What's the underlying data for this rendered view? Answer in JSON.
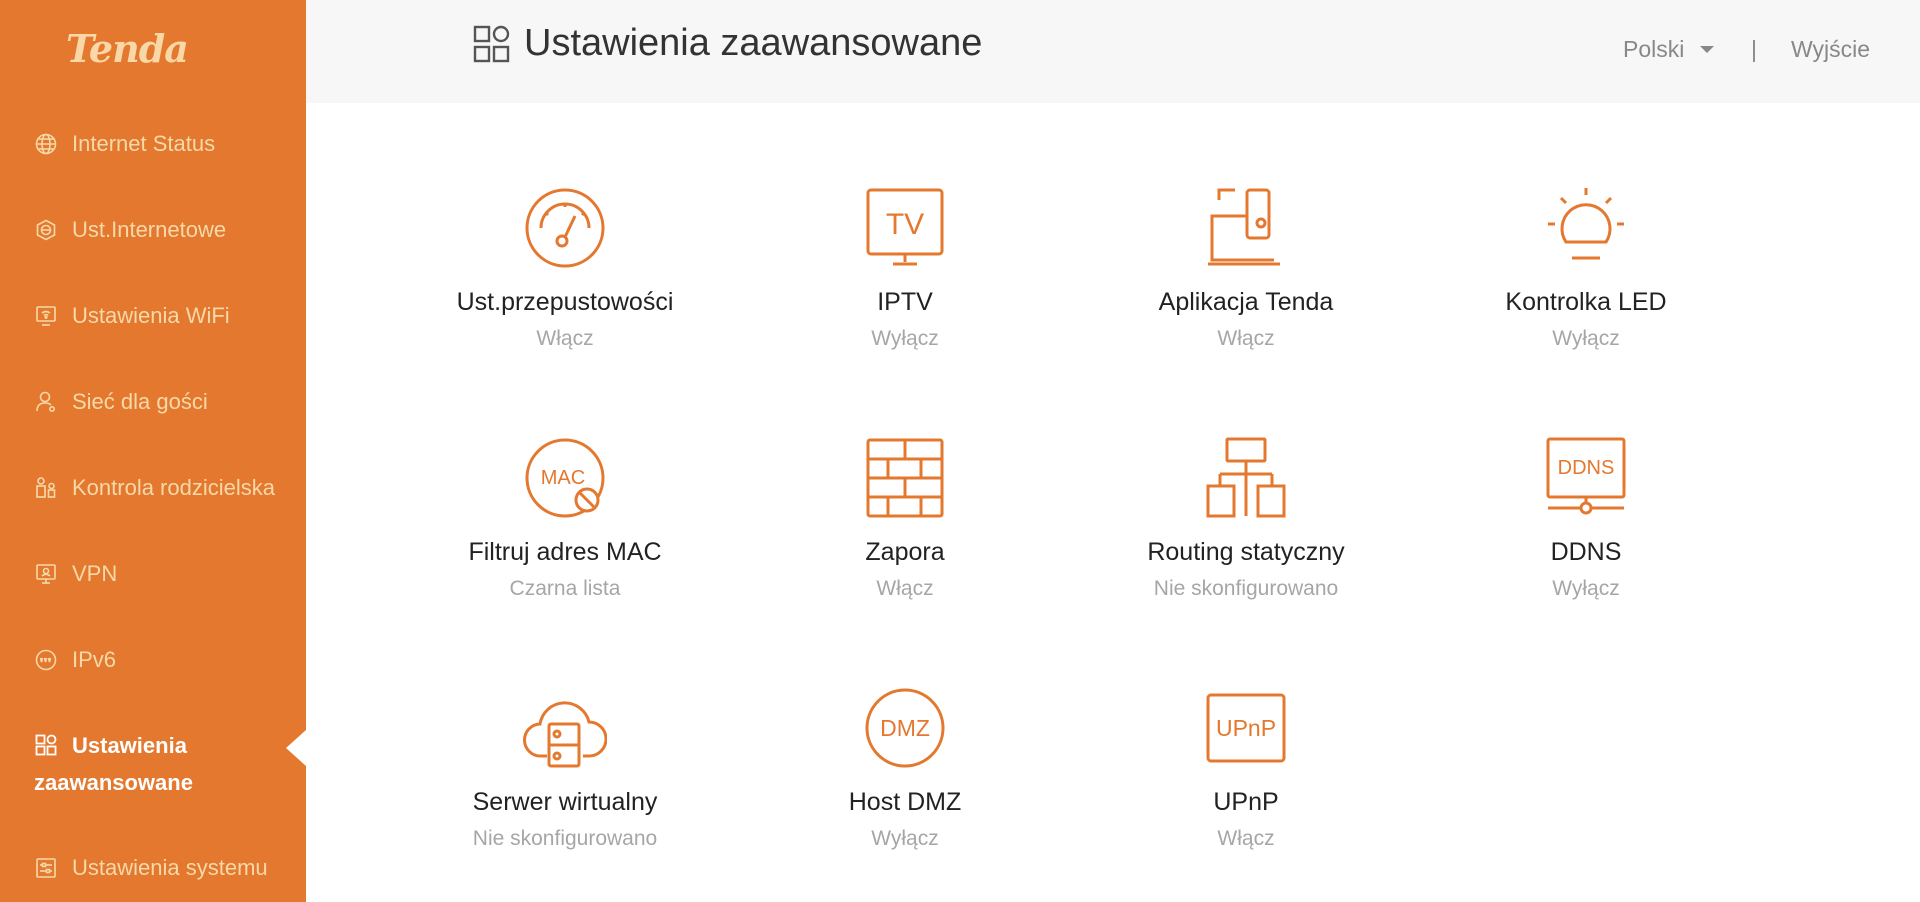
{
  "brand": {
    "logo_text": "Tenda",
    "accent": "#e4782f",
    "nav_text": "#f6d9a8",
    "active_text": "#ffffff"
  },
  "sidebar": {
    "items": [
      {
        "label": "Internet Status",
        "icon": "globe-icon"
      },
      {
        "label": "Ust.Internetowe",
        "icon": "internet-settings-icon"
      },
      {
        "label": "Ustawienia WiFi",
        "icon": "wifi-settings-icon"
      },
      {
        "label": "Sieć dla gości",
        "icon": "guest-icon"
      },
      {
        "label": "Kontrola rodzicielska",
        "icon": "parental-control-icon"
      },
      {
        "label": "VPN",
        "icon": "vpn-icon"
      },
      {
        "label": "IPv6",
        "icon": "ipv6-icon"
      },
      {
        "label_line1": "Ustawienia",
        "label_line2": "zaawansowane",
        "icon": "advanced-grid-icon",
        "active": true
      },
      {
        "label": "Ustawienia systemu",
        "icon": "system-settings-icon"
      }
    ]
  },
  "header": {
    "title": "Ustawienia zaawansowane",
    "language": "Polski",
    "separator": "|",
    "logout": "Wyjście"
  },
  "tiles": [
    {
      "title": "Ust.przepustowości",
      "status": "Włącz",
      "icon": "speedometer-icon"
    },
    {
      "title": "IPTV",
      "status": "Wyłącz",
      "icon": "tv-icon",
      "icon_text": "TV"
    },
    {
      "title": "Aplikacja Tenda",
      "status": "Włącz",
      "icon": "app-devices-icon"
    },
    {
      "title": "Kontrolka LED",
      "status": "Wyłącz",
      "icon": "led-bulb-icon"
    },
    {
      "title": "Filtruj adres MAC",
      "status": "Czarna lista",
      "icon": "mac-filter-icon",
      "icon_text": "MAC"
    },
    {
      "title": "Zapora",
      "status": "Włącz",
      "icon": "firewall-icon"
    },
    {
      "title": "Routing statyczny",
      "status": "Nie skonfigurowano",
      "icon": "routing-tree-icon"
    },
    {
      "title": "DDNS",
      "status": "Wyłącz",
      "icon": "ddns-icon",
      "icon_text": "DDNS"
    },
    {
      "title": "Serwer wirtualny",
      "status": "Nie skonfigurowano",
      "icon": "cloud-server-icon"
    },
    {
      "title": "Host DMZ",
      "status": "Wyłącz",
      "icon": "dmz-icon",
      "icon_text": "DMZ"
    },
    {
      "title": "UPnP",
      "status": "Włącz",
      "icon": "upnp-icon",
      "icon_text": "UPnP"
    }
  ]
}
